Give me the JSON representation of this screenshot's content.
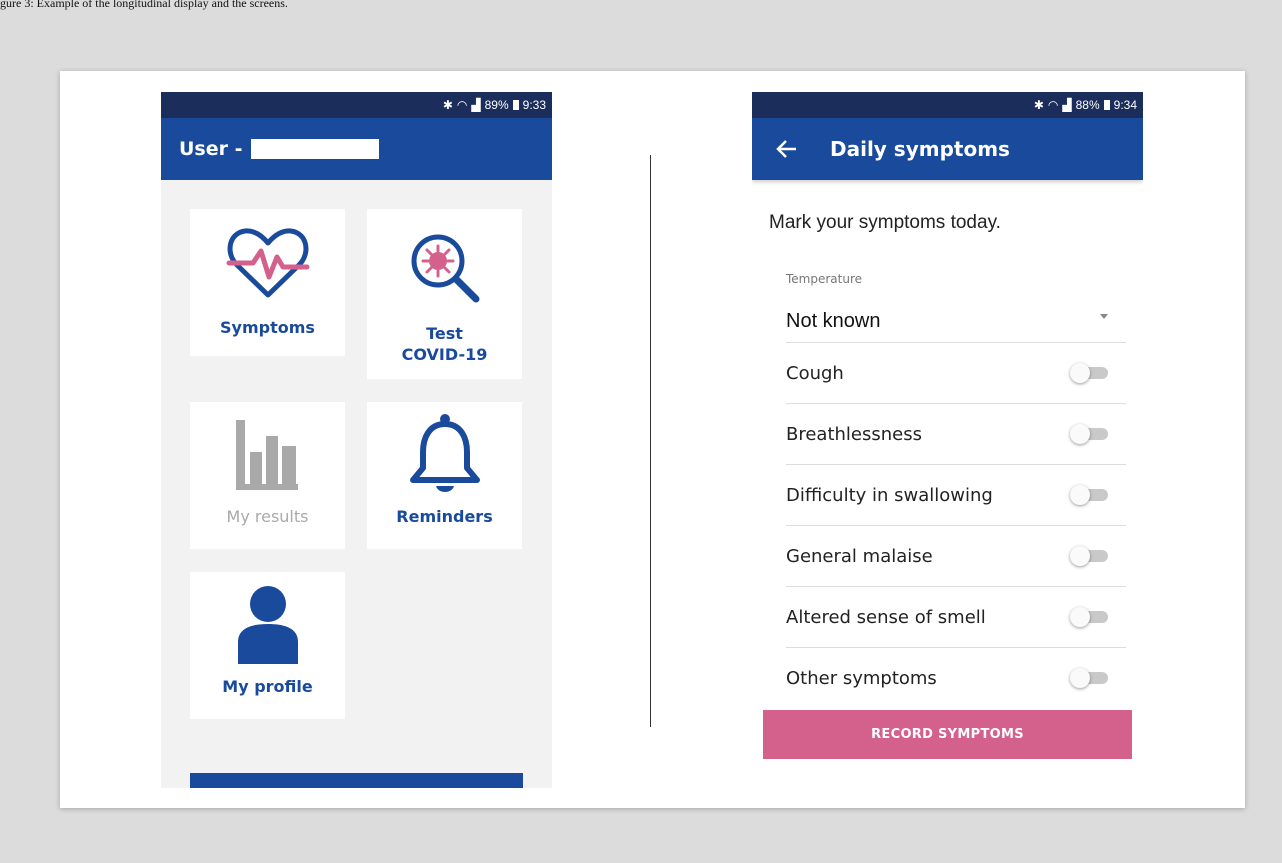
{
  "caption": "gure 3: Example of the longitudinal display and the screens.",
  "phone1": {
    "status": {
      "battery": "89%",
      "time": "9:33"
    },
    "appbar_title": "User -",
    "tiles": [
      {
        "label": "Symptoms",
        "icon": "heart-pulse-icon"
      },
      {
        "label_line1": "Test",
        "label_line2": "COVID-19",
        "icon": "virus-search-icon"
      },
      {
        "label": "My results",
        "icon": "bar-chart-icon"
      },
      {
        "label": "Reminders",
        "icon": "bell-icon"
      },
      {
        "label": "My profile",
        "icon": "person-icon"
      }
    ]
  },
  "phone2": {
    "status": {
      "battery": "88%",
      "time": "9:34"
    },
    "appbar_title": "Daily symptoms",
    "intro": "Mark your symptoms today.",
    "temperature": {
      "label": "Temperature",
      "value": "Not known"
    },
    "symptoms": [
      {
        "label": "Cough",
        "checked": false
      },
      {
        "label": "Breathlessness",
        "checked": false
      },
      {
        "label": "Difficulty in swallowing",
        "checked": false
      },
      {
        "label": "General malaise",
        "checked": false
      },
      {
        "label": "Altered sense of smell",
        "checked": false
      },
      {
        "label": "Other symptoms",
        "checked": false
      }
    ],
    "record_button": "RECORD SYMPTOMS"
  },
  "colors": {
    "primary": "#1a4a9c",
    "accent": "#d4608c",
    "muted": "#a9a9a9",
    "status_bar": "#1b2d5a"
  }
}
